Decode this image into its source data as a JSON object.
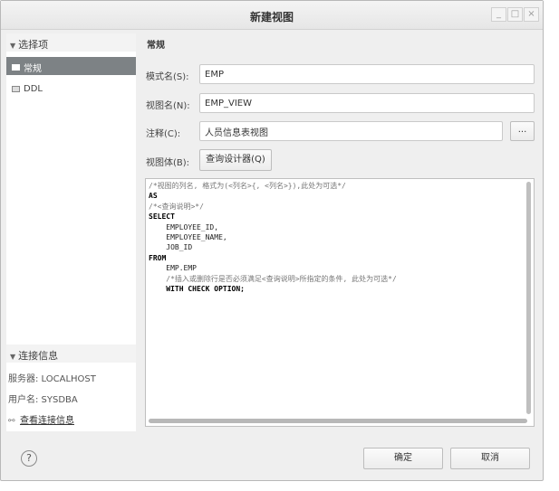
{
  "window": {
    "title": "新建视图",
    "controls": [
      "_",
      "□",
      "×"
    ]
  },
  "left_panel": {
    "options_header": "选择项",
    "items": [
      {
        "label": "常规"
      },
      {
        "label": "DDL"
      }
    ],
    "connection_header": "连接信息",
    "server": "服务器: LOCALHOST",
    "username": "用户名: SYSDBA",
    "view_connection_link": "查看连接信息"
  },
  "form": {
    "section_title": "常规",
    "schema_label": "模式名(S):",
    "schema_value": "EMP",
    "view_name_label": "视图名(N):",
    "view_name_value": "EMP_VIEW",
    "comment_label": "注释(C):",
    "comment_value": "人员信息表视图",
    "comment_more": "...",
    "body_label": "视图体(B):",
    "query_designer": "查询设计器(Q)"
  },
  "sql": {
    "comment_columns": "/*视图的列名, 格式为(<列名>{, <列名>}),此处为可选*/",
    "as_kw": "AS",
    "comment_query": "/*<查询说明>*/",
    "select_kw": "SELECT",
    "col1": "    EMPLOYEE_ID,",
    "col2": "    EMPLOYEE_NAME,",
    "col3": "    JOB_ID",
    "from_kw": "FROM",
    "table": "    EMP.EMP",
    "comment_with": "    /*插入或删除行是否必须满足<查询说明>所指定的条件, 此处为可选*/",
    "with_check": "    WITH CHECK OPTION;"
  },
  "buttons": {
    "help": "?",
    "ok": "确定",
    "cancel": "取消"
  }
}
